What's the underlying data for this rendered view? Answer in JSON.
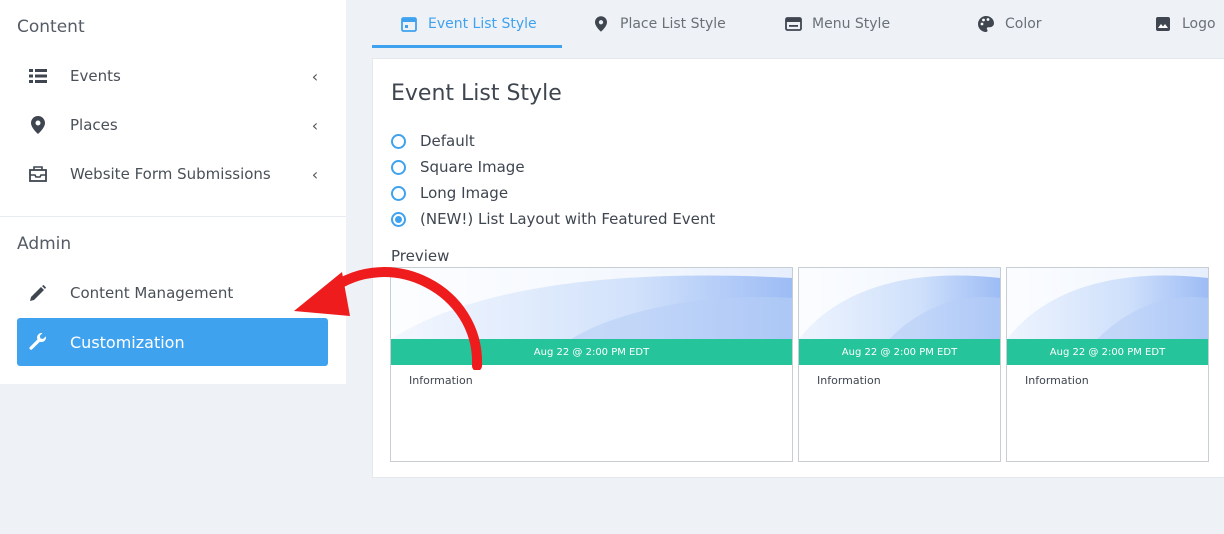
{
  "sidebar": {
    "content_title": "Content",
    "admin_title": "Admin",
    "items": [
      {
        "label": "Events",
        "icon": "list-icon"
      },
      {
        "label": "Places",
        "icon": "map-pin-icon"
      },
      {
        "label": "Website Form Submissions",
        "icon": "inbox-icon"
      },
      {
        "label": "Content Management",
        "icon": "pencil-icon"
      },
      {
        "label": "Customization",
        "icon": "wrench-icon",
        "active": true
      }
    ]
  },
  "tabs": [
    {
      "label": "Event List Style",
      "icon": "calendar-icon",
      "active": true
    },
    {
      "label": "Place List Style",
      "icon": "map-pin-icon"
    },
    {
      "label": "Menu Style",
      "icon": "menu-window-icon"
    },
    {
      "label": "Color",
      "icon": "palette-icon"
    },
    {
      "label": "Logo",
      "icon": "image-icon"
    }
  ],
  "panel": {
    "title": "Event List Style",
    "options": [
      {
        "label": "Default",
        "checked": false
      },
      {
        "label": "Square Image",
        "checked": false
      },
      {
        "label": "Long Image",
        "checked": false
      },
      {
        "label": "(NEW!) List Layout with Featured Event",
        "checked": true
      }
    ],
    "preview_label": "Preview",
    "cards": [
      {
        "date": "Aug 22 @ 2:00 PM EDT",
        "info": "Information"
      },
      {
        "date": "Aug 22 @ 2:00 PM EDT",
        "info": "Information"
      },
      {
        "date": "Aug 22 @ 2:00 PM EDT",
        "info": "Information"
      }
    ]
  },
  "colors": {
    "accent": "#3fa2ef",
    "band": "#26c49b",
    "arrow": "#ee1c1c"
  }
}
